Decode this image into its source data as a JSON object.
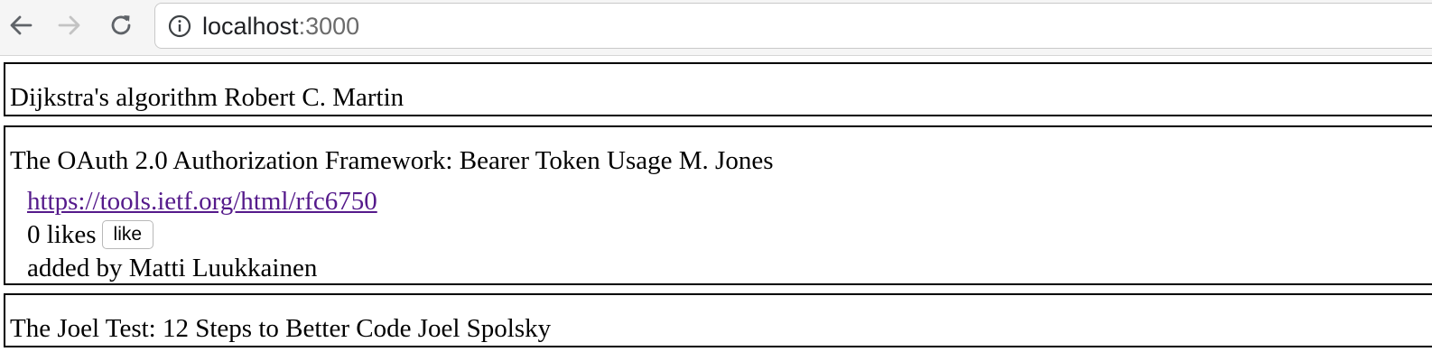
{
  "browser": {
    "url_host": "localhost",
    "url_port": ":3000"
  },
  "blogs": [
    {
      "title": "Dijkstra's algorithm Robert C. Martin"
    },
    {
      "title": "The OAuth 2.0 Authorization Framework: Bearer Token Usage M. Jones",
      "url": "https://tools.ietf.org/html/rfc6750",
      "likes_text": "0 likes",
      "like_button": "like",
      "added_by": "added by Matti Luukkainen"
    },
    {
      "title": "The Joel Test: 12 Steps to Better Code Joel Spolsky"
    }
  ],
  "colors": {
    "link": "#551a8b",
    "border": "#000000",
    "toolbar": "#f5f5f5"
  },
  "icons": [
    "back-arrow-icon",
    "forward-arrow-icon",
    "reload-icon",
    "info-icon"
  ]
}
